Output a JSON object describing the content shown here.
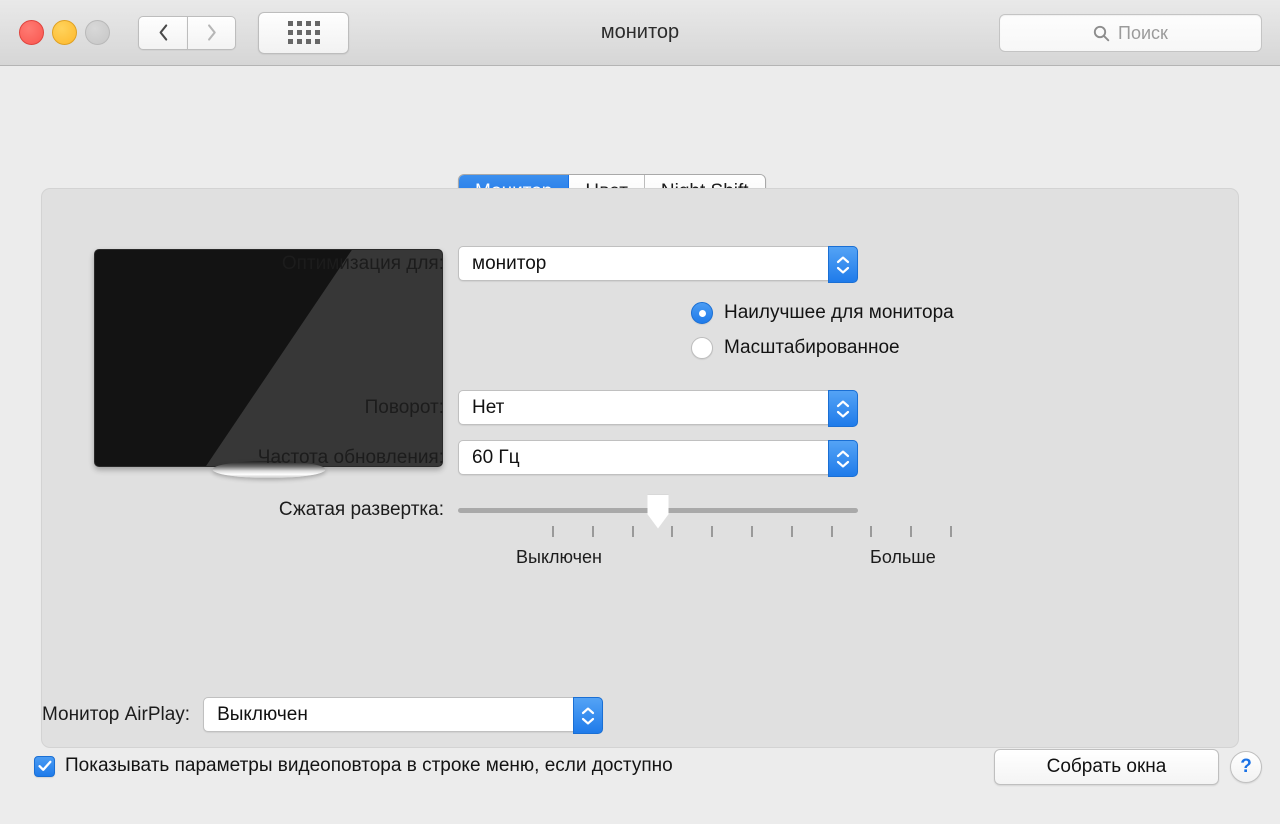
{
  "window": {
    "title": "монитор",
    "traffic_lights": [
      {
        "name": "close",
        "color": "#f9564f"
      },
      {
        "name": "minimize",
        "color": "#fdb82c"
      },
      {
        "name": "zoom",
        "color": "#c6c6c6"
      }
    ],
    "nav": {
      "back_icon": "chevron-left-icon",
      "forward_icon": "chevron-right-icon",
      "grid_icon": "show-all-grid-icon"
    }
  },
  "search": {
    "placeholder": "Поиск",
    "value": "",
    "icon": "search-icon"
  },
  "tabs": [
    {
      "label": "Монитор",
      "active": true
    },
    {
      "label": "Цвет",
      "active": false
    },
    {
      "label": "Night Shift",
      "active": false
    }
  ],
  "display_preview": {
    "name": "monitor-illustration"
  },
  "form": {
    "optimize": {
      "label": "Оптимизация для:",
      "value": "монитор"
    },
    "resolution_options": [
      {
        "label": "Наилучшее для монитора",
        "selected": true
      },
      {
        "label": "Масштабированное",
        "selected": false
      }
    ],
    "rotation": {
      "label": "Поворот:",
      "value": "Нет"
    },
    "refresh_rate": {
      "label": "Частота обновления:",
      "value": "60 Гц"
    },
    "overscan": {
      "label": "Сжатая развертка:",
      "min_label": "Выключен",
      "max_label": "Больше",
      "ticks": 11,
      "value_index": 5,
      "percent": 50
    }
  },
  "bottom": {
    "airplay": {
      "label": "Монитор AirPlay:",
      "value": "Выключен"
    },
    "mirroring_checkbox": {
      "label": "Показывать параметры видеоповтора в строке меню, если доступно",
      "checked": true
    },
    "gather_windows_button": "Собрать окна",
    "help_button": "?"
  },
  "colors": {
    "accent": "#1f7bea",
    "window_bg": "#ececec",
    "panel_bg": "#e0e0e0",
    "titlebar_bg": "#dcdcdc"
  }
}
